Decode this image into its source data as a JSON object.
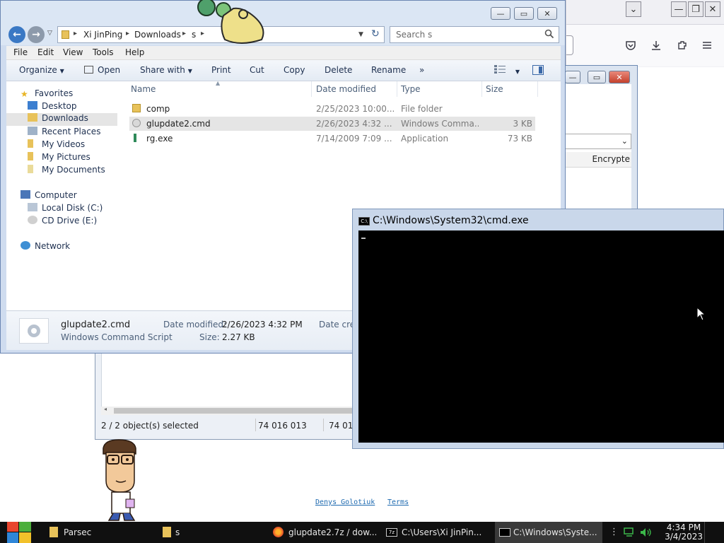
{
  "explorer": {
    "breadcrumb": [
      "Xi JinPing",
      "Downloads",
      "s"
    ],
    "search_placeholder": "Search s",
    "menu": [
      "File",
      "Edit",
      "View",
      "Tools",
      "Help"
    ],
    "toolbar": {
      "organize": "Organize",
      "open": "Open",
      "share_with": "Share with",
      "print": "Print",
      "cut": "Cut",
      "copy": "Copy",
      "delete": "Delete",
      "rename": "Rename",
      "more": "»"
    },
    "nav": {
      "favorites": "Favorites",
      "desktop": "Desktop",
      "downloads": "Downloads",
      "recent_places": "Recent Places",
      "my_videos": "My Videos",
      "my_pictures": "My Pictures",
      "my_documents": "My Documents",
      "computer": "Computer",
      "local_disk": "Local Disk (C:)",
      "cd_drive": "CD Drive (E:)",
      "network": "Network"
    },
    "columns": {
      "name": "Name",
      "date_modified": "Date modified",
      "type": "Type",
      "size": "Size"
    },
    "files": [
      {
        "name": "comp",
        "date": "2/25/2023 10:00...",
        "type": "File folder",
        "size": ""
      },
      {
        "name": "glupdate2.cmd",
        "date": "2/26/2023 4:32 ...",
        "type": "Windows Comma...",
        "size": "3 KB"
      },
      {
        "name": "rg.exe",
        "date": "7/14/2009 7:09 ...",
        "type": "Application",
        "size": "73 KB"
      }
    ],
    "details": {
      "filename": "glupdate2.cmd",
      "filetype": "Windows Command Script",
      "date_label": "Date modified:",
      "date_value": "2/26/2023 4:32 PM",
      "size_label": "Size:",
      "size_value": "2.27 KB",
      "date_created_label": "Date cre"
    }
  },
  "cmd": {
    "title": "C:\\Windows\\System32\\cmd.exe",
    "icon_text": "C:\\"
  },
  "zip": {
    "status_selected": "2 / 2 object(s) selected",
    "size1": "74 016 013",
    "size2": "74 01"
  },
  "dialog2": {
    "column": "Encrypte"
  },
  "footer": {
    "author": "Denys Golotiuk",
    "terms": "Terms"
  },
  "taskbar": {
    "items": [
      {
        "label": "Parsec"
      },
      {
        "label": "s"
      },
      {
        "label": "glupdate2.7z / dow..."
      },
      {
        "label": "C:\\Users\\Xi JinPin..."
      },
      {
        "label": "C:\\Windows\\Syste..."
      }
    ],
    "time": "4:34 PM",
    "date": "3/4/2023"
  },
  "colors": {
    "taskbar_bg": "#101010",
    "explorer_frame": "#cfdcef",
    "console_bg": "#000000",
    "selection": "#e5e5e5",
    "link": "#1e6ab0"
  }
}
